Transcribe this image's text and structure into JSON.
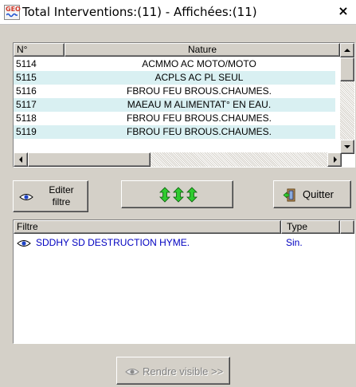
{
  "window": {
    "title": "Total Interventions:(11) - Affichées:(11)",
    "app_icon_text": "GEO"
  },
  "interventions": {
    "columns": [
      "N°",
      "Nature"
    ],
    "rows": [
      {
        "num": "5114",
        "nature": "ACMMO AC MOTO/MOTO"
      },
      {
        "num": "5115",
        "nature": "ACPLS  AC PL SEUL"
      },
      {
        "num": "5116",
        "nature": "FBROU  FEU BROUS.CHAUMES."
      },
      {
        "num": "5117",
        "nature": "MAEAU  M ALIMENTAT° EN EAU."
      },
      {
        "num": "5118",
        "nature": "FBROU  FEU BROUS.CHAUMES."
      },
      {
        "num": "5119",
        "nature": "FBROU  FEU BROUS.CHAUMES."
      }
    ]
  },
  "toolbar": {
    "edit_label_line1": "Editer",
    "edit_label_line2": "filtre",
    "quit_label": "Quitter"
  },
  "filters": {
    "columns": [
      "Filtre",
      "Type"
    ],
    "rows": [
      {
        "filter": "SDDHY  SD DESTRUCTION HYME.",
        "type": "Sin."
      }
    ]
  },
  "footer": {
    "make_visible_label": "Rendre visible >>"
  },
  "colors": {
    "alt_row": "#d9f0f2",
    "filter_text": "#0000c0",
    "arrow_green": "#2fcb2f"
  }
}
